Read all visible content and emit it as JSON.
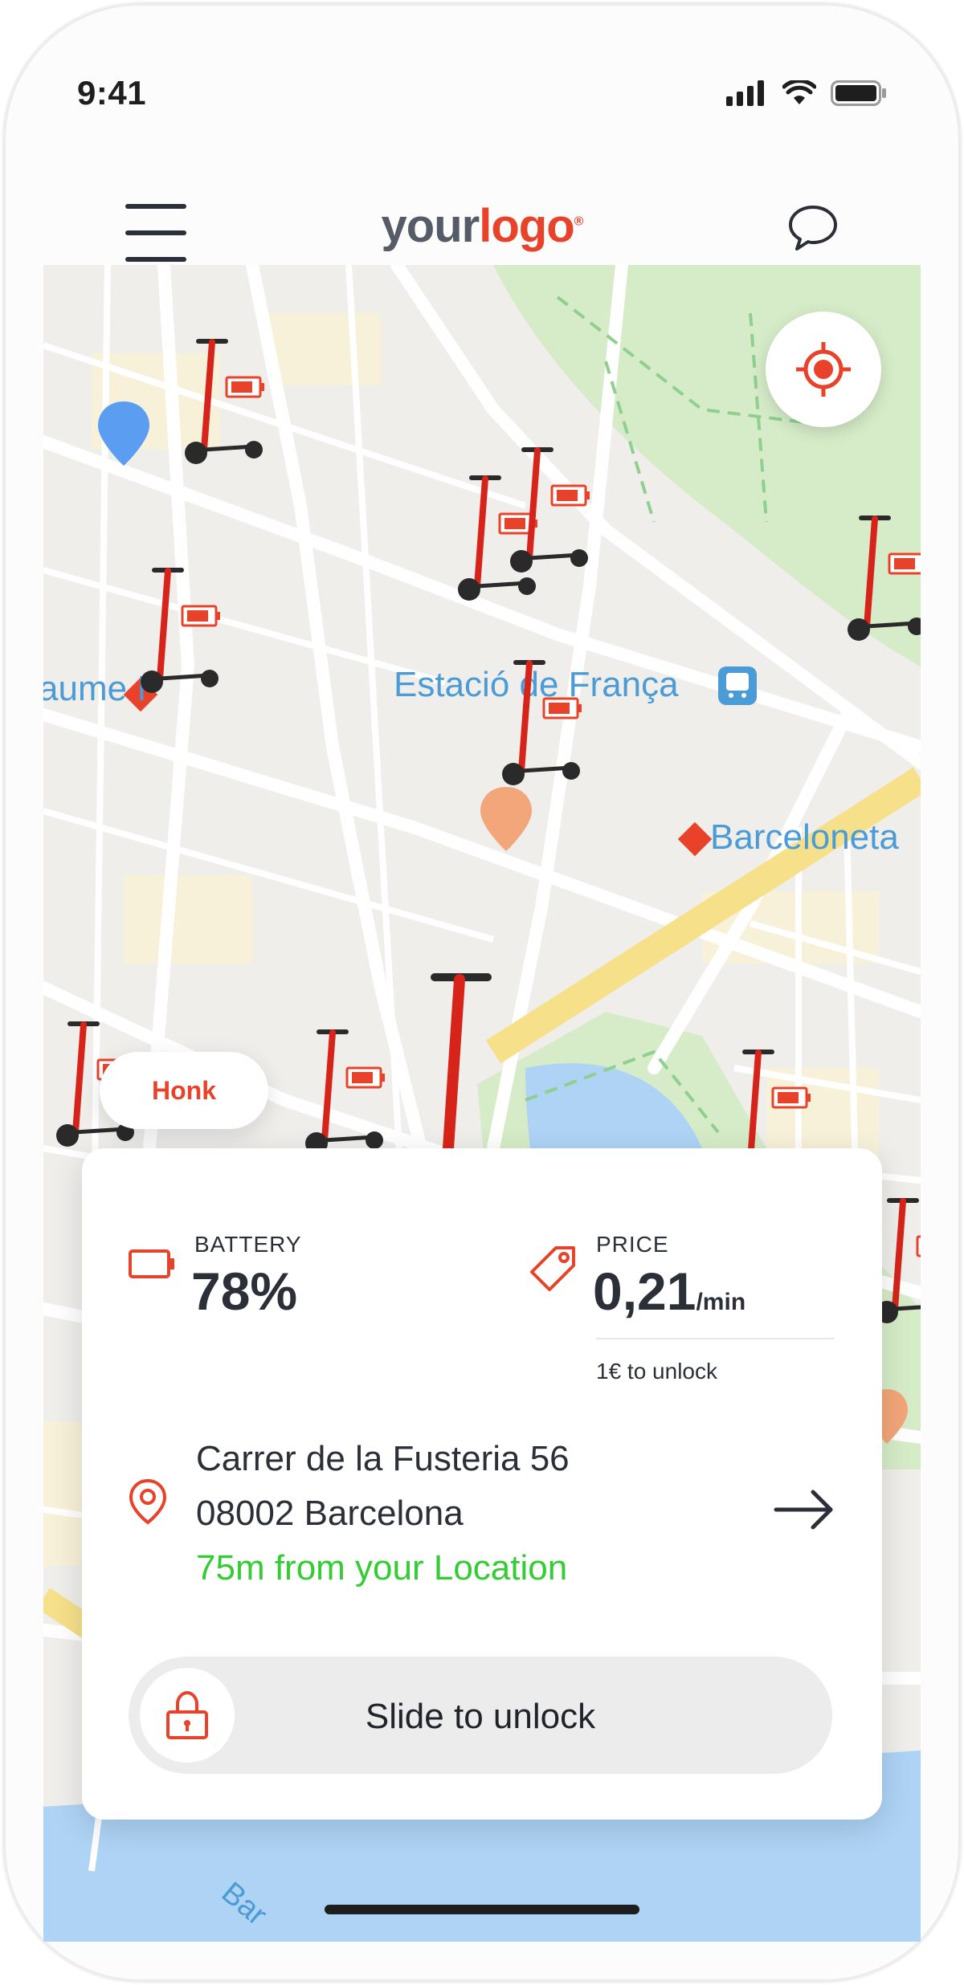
{
  "status_bar": {
    "time": "9:41"
  },
  "header": {
    "logo_part1": "your",
    "logo_part2": "logo",
    "logo_mark": "®"
  },
  "map": {
    "labels": [
      {
        "text": "aume I"
      },
      {
        "text": "Estació de França"
      },
      {
        "text": "Barceloneta"
      },
      {
        "text": "Bar"
      }
    ]
  },
  "honk": {
    "label": "Honk"
  },
  "card": {
    "battery": {
      "label": "BATTERY",
      "value": "78%"
    },
    "price": {
      "label": "PRICE",
      "value": "0,21",
      "unit": "/min",
      "unlock_fee": "1€ to unlock"
    },
    "address": {
      "line1": "Carrer de la Fusteria 56",
      "line2": "08002 Barcelona",
      "distance": "75m from your Location"
    },
    "slider": {
      "label": "Slide to unlock"
    }
  },
  "colors": {
    "accent": "#e8432a",
    "green": "#33cc33",
    "text": "#2b2f38",
    "map_water": "#aed3f5",
    "map_park": "#d6ecc8"
  },
  "icons": [
    "menu-icon",
    "chat-icon",
    "locate-icon",
    "battery-icon",
    "price-tag-icon",
    "location-pin-icon",
    "arrow-right-icon",
    "lock-icon"
  ]
}
